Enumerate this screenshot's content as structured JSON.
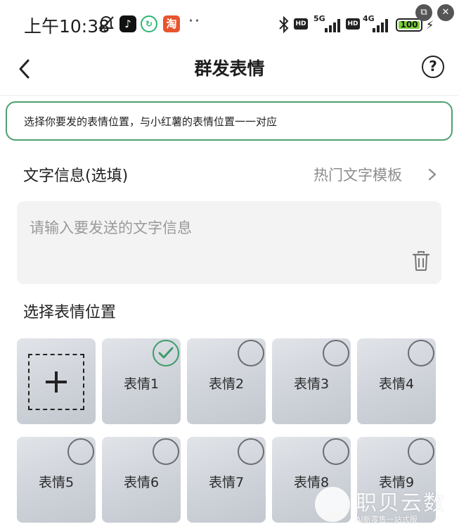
{
  "status_bar": {
    "time": "上午10:38",
    "apps": {
      "tiktok": "♪",
      "chat": "↻",
      "taobao": "淘"
    },
    "dots": "··",
    "hd_1": "HD",
    "hd_2": "HD",
    "net_1": "5G",
    "net_2": "4G",
    "battery": "100",
    "battery_level": 1.0,
    "corner_left": "⧉",
    "corner_right": "✕"
  },
  "nav": {
    "title": "群发表情",
    "help": "?"
  },
  "tip": {
    "text": "选择你要发的表情位置，与小红薯的表情位置一一对应"
  },
  "text_section": {
    "label": "文字信息(选填)",
    "template_link": "热门文字模板",
    "placeholder": "请输入要发送的文字信息"
  },
  "emoji_section": {
    "label": "选择表情位置",
    "tiles": [
      {
        "label": "表情1",
        "checked": true
      },
      {
        "label": "表情2",
        "checked": false
      },
      {
        "label": "表情3",
        "checked": false
      },
      {
        "label": "表情4",
        "checked": false
      },
      {
        "label": "表情5",
        "checked": false
      },
      {
        "label": "表情6",
        "checked": false
      },
      {
        "label": "表情7",
        "checked": false
      },
      {
        "label": "表情8",
        "checked": false
      },
      {
        "label": "表情9",
        "checked": false
      }
    ]
  },
  "watermark": {
    "title": "职贝云数",
    "subtitle": "AI新零售一站式服"
  },
  "colors": {
    "accent_green": "#3f9b69",
    "tip_border": "#4f9f72",
    "input_bg": "#f3f3f3"
  }
}
